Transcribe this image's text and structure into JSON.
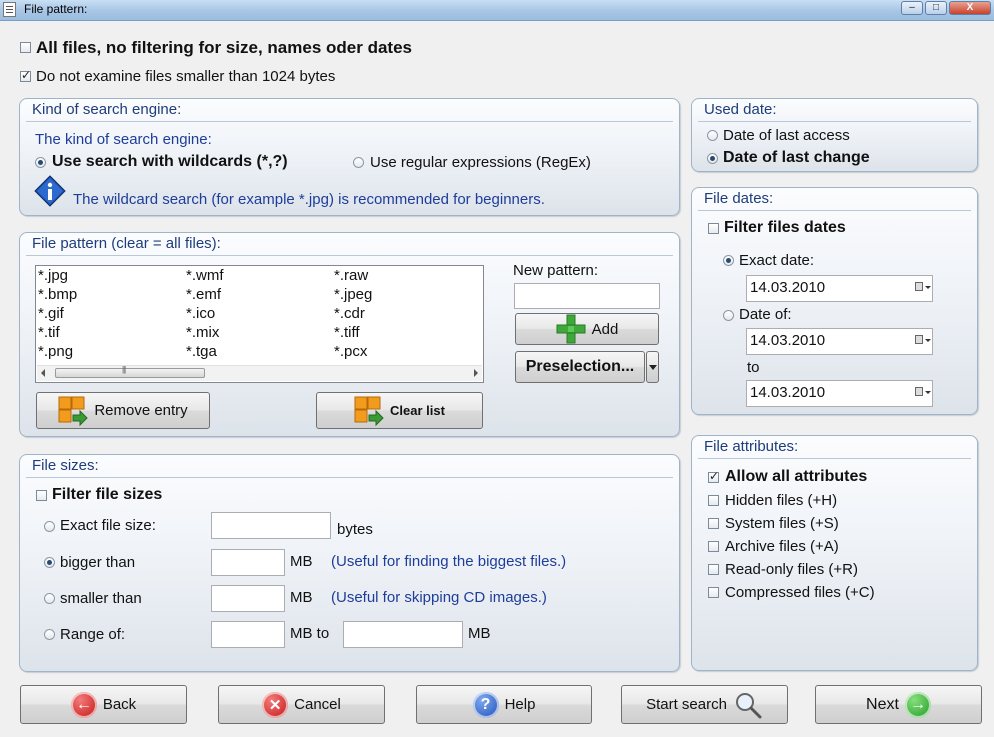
{
  "window": {
    "title": "File pattern:",
    "minimize": "–",
    "maximize": "□",
    "close": "X"
  },
  "top": {
    "all_files_label": "All files, no filtering for size, names oder dates",
    "all_files_checked": false,
    "min_size_label": "Do not examine files smaller than 1024 bytes",
    "min_size_checked": true
  },
  "engine": {
    "group_title": "Kind of search engine:",
    "prompt": "The kind of search engine:",
    "wildcards_label": "Use search with wildcards (*,?)",
    "regex_label": "Use regular expressions (RegEx)",
    "selected": "wildcards",
    "info_text": "The wildcard search (for example *.jpg) is recommended for beginners."
  },
  "pattern": {
    "group_title": "File pattern (clear = all files):",
    "items": [
      "*.jpg",
      "*.bmp",
      "*.gif",
      "*.tif",
      "*.png",
      "*.wmf",
      "*.emf",
      "*.ico",
      "*.mix",
      "*.tga",
      "*.raw",
      "*.jpeg",
      "*.cdr",
      "*.tiff",
      "*.pcx"
    ],
    "new_pattern_label": "New pattern:",
    "new_pattern_value": "",
    "add_label": "Add",
    "preselection_label": "Preselection...",
    "remove_label": "Remove entry",
    "clear_label": "Clear list"
  },
  "sizes": {
    "group_title": "File sizes:",
    "filter_label": "Filter file sizes",
    "filter_checked": false,
    "exact_label": "Exact file size:",
    "exact_unit": "bytes",
    "bigger_label": "bigger than",
    "bigger_unit": "MB",
    "bigger_hint": "(Useful for finding the biggest files.)",
    "smaller_label": "smaller than",
    "smaller_unit": "MB",
    "smaller_hint": "(Useful for skipping CD images.)",
    "range_label": "Range of:",
    "range_unit_mid": "MB to",
    "range_unit_end": "MB",
    "selected": "bigger"
  },
  "used_date": {
    "group_title": "Used date:",
    "last_access_label": "Date of last access",
    "last_change_label": "Date of last change",
    "selected": "last_change"
  },
  "file_dates": {
    "group_title": "File dates:",
    "filter_label": "Filter files dates",
    "filter_checked": false,
    "exact_label": "Exact date:",
    "exact_value": "14.03.2010",
    "date_of_label": "Date of:",
    "from_value": "14.03.2010",
    "to_label": "to",
    "to_value": "14.03.2010",
    "selected": "exact"
  },
  "attributes": {
    "group_title": "File attributes:",
    "allow_all_label": "Allow all attributes",
    "hidden_label": "Hidden files (+H)",
    "system_label": "System files (+S)",
    "archive_label": "Archive files (+A)",
    "readonly_label": "Read-only files (+R)",
    "compressed_label": "Compressed files (+C)"
  },
  "footer": {
    "back_label": "Back",
    "cancel_label": "Cancel",
    "help_label": "Help",
    "start_search_label": "Start search",
    "next_label": "Next"
  }
}
